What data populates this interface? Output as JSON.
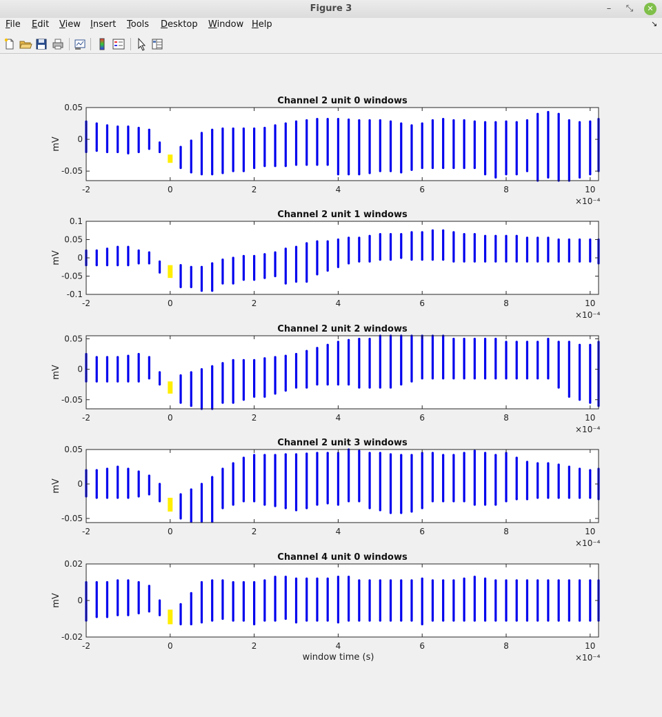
{
  "window": {
    "title": "Figure 3"
  },
  "menu": [
    "File",
    "Edit",
    "View",
    "Insert",
    "Tools",
    "Desktop",
    "Window",
    "Help"
  ],
  "menu_mnemonics": [
    "F",
    "E",
    "V",
    "I",
    "T",
    "D",
    "W",
    "H"
  ],
  "toolbar_icons": [
    "new-figure-icon",
    "open-file-icon",
    "save-icon",
    "print-icon",
    "link-plot-icon",
    "colorbar-icon",
    "legend-icon",
    "pointer-icon",
    "property-editor-icon"
  ],
  "colors": {
    "data": "#0000ee",
    "highlight": "#ffee00"
  },
  "chart_data": [
    {
      "type": "scatter",
      "title": "Channel 2 unit 0 windows",
      "xlabel": "",
      "ylabel": "mV",
      "xlim": [
        -2,
        10.2
      ],
      "ylim": [
        -0.065,
        0.05
      ],
      "xticks": [
        -2,
        0,
        2,
        4,
        6,
        8,
        10
      ],
      "yticks": [
        0.05,
        0,
        -0.05
      ],
      "ytick_labels": [
        "0.05",
        "0",
        "-0.05"
      ],
      "x_exponent_label": "×10⁻⁴",
      "highlight_x": 0,
      "highlight_range": [
        -0.037,
        -0.024
      ],
      "x": [
        -2,
        -1.75,
        -1.5,
        -1.25,
        -1,
        -0.75,
        -0.5,
        -0.25,
        0.25,
        0.5,
        0.75,
        1,
        1.25,
        1.5,
        1.75,
        2,
        2.25,
        2.5,
        2.75,
        3,
        3.25,
        3.5,
        3.75,
        4,
        4.25,
        4.5,
        4.75,
        5,
        5.25,
        5.5,
        5.75,
        6,
        6.25,
        6.5,
        6.75,
        7,
        7.25,
        7.5,
        7.75,
        8,
        8.25,
        8.5,
        8.75,
        9,
        9.25,
        9.5,
        9.75,
        10,
        10.2
      ],
      "y_top": [
        0.028,
        0.025,
        0.022,
        0.02,
        0.02,
        0.018,
        0.015,
        -0.005,
        -0.012,
        -0.002,
        0.01,
        0.015,
        0.017,
        0.017,
        0.017,
        0.017,
        0.018,
        0.022,
        0.025,
        0.028,
        0.03,
        0.032,
        0.032,
        0.032,
        0.031,
        0.03,
        0.03,
        0.03,
        0.028,
        0.025,
        0.022,
        0.025,
        0.03,
        0.032,
        0.03,
        0.03,
        0.028,
        0.027,
        0.027,
        0.028,
        0.027,
        0.03,
        0.04,
        0.043,
        0.04,
        0.03,
        0.027,
        0.028,
        0.032
      ],
      "y_bottom": [
        -0.02,
        -0.018,
        -0.02,
        -0.02,
        -0.022,
        -0.02,
        -0.015,
        -0.02,
        -0.045,
        -0.052,
        -0.055,
        -0.055,
        -0.053,
        -0.05,
        -0.05,
        -0.045,
        -0.042,
        -0.042,
        -0.042,
        -0.04,
        -0.04,
        -0.04,
        -0.04,
        -0.055,
        -0.055,
        -0.055,
        -0.053,
        -0.05,
        -0.05,
        -0.052,
        -0.048,
        -0.045,
        -0.045,
        -0.045,
        -0.045,
        -0.045,
        -0.045,
        -0.055,
        -0.06,
        -0.055,
        -0.055,
        -0.05,
        -0.065,
        -0.06,
        -0.065,
        -0.065,
        -0.06,
        -0.055,
        -0.05
      ]
    },
    {
      "type": "scatter",
      "title": "Channel 2 unit 1 windows",
      "xlabel": "",
      "ylabel": "mV",
      "xlim": [
        -2,
        10.2
      ],
      "ylim": [
        -0.1,
        0.1
      ],
      "xticks": [
        -2,
        0,
        2,
        4,
        6,
        8,
        10
      ],
      "yticks": [
        0.1,
        0.05,
        0,
        -0.05,
        -0.1
      ],
      "ytick_labels": [
        "0.1",
        "0.05",
        "0",
        "-0.05",
        "-0.1"
      ],
      "x_exponent_label": "×10⁻⁴",
      "highlight_x": 0,
      "highlight_range": [
        -0.055,
        -0.02
      ],
      "x": [
        -2,
        -1.75,
        -1.5,
        -1.25,
        -1,
        -0.75,
        -0.5,
        -0.25,
        0.25,
        0.5,
        0.75,
        1,
        1.25,
        1.5,
        1.75,
        2,
        2.25,
        2.5,
        2.75,
        3,
        3.25,
        3.5,
        3.75,
        4,
        4.25,
        4.5,
        4.75,
        5,
        5.25,
        5.5,
        5.75,
        6,
        6.25,
        6.5,
        6.75,
        7,
        7.25,
        7.5,
        7.75,
        8,
        8.25,
        8.5,
        8.75,
        9,
        9.25,
        9.5,
        9.75,
        10,
        10.2
      ],
      "y_top": [
        0.02,
        0.02,
        0.025,
        0.03,
        0.03,
        0.02,
        0.015,
        -0.01,
        -0.02,
        -0.025,
        -0.025,
        -0.015,
        -0.005,
        0.0,
        0.005,
        0.005,
        0.01,
        0.015,
        0.025,
        0.03,
        0.04,
        0.045,
        0.045,
        0.05,
        0.055,
        0.055,
        0.06,
        0.065,
        0.065,
        0.065,
        0.07,
        0.07,
        0.075,
        0.075,
        0.07,
        0.065,
        0.065,
        0.06,
        0.06,
        0.06,
        0.06,
        0.055,
        0.055,
        0.055,
        0.05,
        0.05,
        0.05,
        0.05,
        0.05
      ],
      "y_bottom": [
        -0.02,
        -0.02,
        -0.02,
        -0.02,
        -0.02,
        -0.015,
        -0.015,
        -0.04,
        -0.08,
        -0.08,
        -0.09,
        -0.09,
        -0.07,
        -0.07,
        -0.06,
        -0.06,
        -0.055,
        -0.05,
        -0.07,
        -0.065,
        -0.065,
        -0.045,
        -0.035,
        -0.025,
        -0.015,
        -0.01,
        -0.01,
        -0.005,
        -0.005,
        0.0,
        -0.005,
        -0.005,
        -0.005,
        -0.005,
        -0.01,
        -0.01,
        -0.01,
        -0.01,
        -0.01,
        -0.01,
        -0.01,
        -0.01,
        -0.01,
        -0.01,
        -0.01,
        -0.01,
        -0.01,
        -0.01,
        -0.015
      ]
    },
    {
      "type": "scatter",
      "title": "Channel 2 unit 2 windows",
      "xlabel": "",
      "ylabel": "mV",
      "xlim": [
        -2,
        10.2
      ],
      "ylim": [
        -0.065,
        0.055
      ],
      "xticks": [
        -2,
        0,
        2,
        4,
        6,
        8,
        10
      ],
      "yticks": [
        0.05,
        0,
        -0.05
      ],
      "ytick_labels": [
        "0.05",
        "0",
        "-0.05"
      ],
      "x_exponent_label": "×10⁻⁴",
      "highlight_x": 0,
      "highlight_range": [
        -0.04,
        -0.02
      ],
      "x": [
        -2,
        -1.75,
        -1.5,
        -1.25,
        -1,
        -0.75,
        -0.5,
        -0.25,
        0.25,
        0.5,
        0.75,
        1,
        1.25,
        1.5,
        1.75,
        2,
        2.25,
        2.5,
        2.75,
        3,
        3.25,
        3.5,
        3.75,
        4,
        4.25,
        4.5,
        4.75,
        5,
        5.25,
        5.5,
        5.75,
        6,
        6.25,
        6.5,
        6.75,
        7,
        7.25,
        7.5,
        7.75,
        8,
        8.25,
        8.5,
        8.75,
        9,
        9.25,
        9.5,
        9.75,
        10,
        10.2
      ],
      "y_top": [
        0.025,
        0.02,
        0.02,
        0.02,
        0.022,
        0.025,
        0.02,
        -0.005,
        -0.01,
        -0.005,
        0.0,
        0.005,
        0.01,
        0.015,
        0.015,
        0.015,
        0.018,
        0.02,
        0.022,
        0.025,
        0.03,
        0.035,
        0.04,
        0.045,
        0.048,
        0.05,
        0.05,
        0.055,
        0.055,
        0.055,
        0.055,
        0.055,
        0.055,
        0.055,
        0.05,
        0.05,
        0.05,
        0.05,
        0.05,
        0.045,
        0.045,
        0.045,
        0.045,
        0.05,
        0.045,
        0.045,
        0.04,
        0.04,
        0.045
      ],
      "y_bottom": [
        -0.02,
        -0.02,
        -0.02,
        -0.02,
        -0.02,
        -0.02,
        -0.015,
        -0.025,
        -0.055,
        -0.06,
        -0.065,
        -0.065,
        -0.055,
        -0.055,
        -0.05,
        -0.045,
        -0.045,
        -0.04,
        -0.035,
        -0.03,
        -0.03,
        -0.025,
        -0.025,
        -0.025,
        -0.025,
        -0.03,
        -0.03,
        -0.03,
        -0.03,
        -0.025,
        -0.02,
        -0.015,
        -0.015,
        -0.015,
        -0.015,
        -0.015,
        -0.015,
        -0.015,
        -0.015,
        -0.015,
        -0.015,
        -0.015,
        -0.015,
        -0.015,
        -0.03,
        -0.045,
        -0.05,
        -0.055,
        -0.06
      ]
    },
    {
      "type": "scatter",
      "title": "Channel 2 unit 3 windows",
      "xlabel": "",
      "ylabel": "mV",
      "xlim": [
        -2,
        10.2
      ],
      "ylim": [
        -0.056,
        0.05
      ],
      "xticks": [
        -2,
        0,
        2,
        4,
        6,
        8,
        10
      ],
      "yticks": [
        0.05,
        0,
        -0.05
      ],
      "ytick_labels": [
        "0.05",
        "0",
        "-0.05"
      ],
      "x_exponent_label": "×10⁻⁴",
      "highlight_x": 0,
      "highlight_range": [
        -0.04,
        -0.02
      ],
      "x": [
        -2,
        -1.75,
        -1.5,
        -1.25,
        -1,
        -0.75,
        -0.5,
        -0.25,
        0.25,
        0.5,
        0.75,
        1,
        1.25,
        1.5,
        1.75,
        2,
        2.25,
        2.5,
        2.75,
        3,
        3.25,
        3.5,
        3.75,
        4,
        4.25,
        4.5,
        4.75,
        5,
        5.25,
        5.5,
        5.75,
        6,
        6.25,
        6.5,
        6.75,
        7,
        7.25,
        7.5,
        7.75,
        8,
        8.25,
        8.5,
        8.75,
        9,
        9.25,
        9.5,
        9.75,
        10,
        10.2
      ],
      "y_top": [
        0.02,
        0.02,
        0.022,
        0.025,
        0.022,
        0.018,
        0.012,
        0.0,
        -0.015,
        -0.008,
        0.0,
        0.01,
        0.022,
        0.03,
        0.038,
        0.042,
        0.042,
        0.042,
        0.043,
        0.043,
        0.044,
        0.045,
        0.045,
        0.045,
        0.05,
        0.048,
        0.045,
        0.045,
        0.043,
        0.042,
        0.042,
        0.045,
        0.045,
        0.042,
        0.042,
        0.045,
        0.048,
        0.045,
        0.042,
        0.045,
        0.038,
        0.032,
        0.03,
        0.03,
        0.028,
        0.025,
        0.022,
        0.02,
        0.022
      ],
      "y_bottom": [
        -0.018,
        -0.02,
        -0.02,
        -0.02,
        -0.02,
        -0.018,
        -0.015,
        -0.025,
        -0.05,
        -0.055,
        -0.055,
        -0.055,
        -0.035,
        -0.03,
        -0.025,
        -0.025,
        -0.03,
        -0.032,
        -0.035,
        -0.038,
        -0.035,
        -0.03,
        -0.028,
        -0.03,
        -0.025,
        -0.025,
        -0.035,
        -0.038,
        -0.042,
        -0.042,
        -0.04,
        -0.035,
        -0.025,
        -0.025,
        -0.025,
        -0.025,
        -0.03,
        -0.03,
        -0.03,
        -0.025,
        -0.022,
        -0.022,
        -0.02,
        -0.02,
        -0.02,
        -0.02,
        -0.02,
        -0.02,
        -0.022
      ]
    },
    {
      "type": "scatter",
      "title": "Channel 4 unit 0 windows",
      "xlabel": "window time (s)",
      "ylabel": "mV",
      "xlim": [
        -2,
        10.2
      ],
      "ylim": [
        -0.02,
        0.02
      ],
      "xticks": [
        -2,
        0,
        2,
        4,
        6,
        8,
        10
      ],
      "yticks": [
        0.02,
        0,
        -0.02
      ],
      "ytick_labels": [
        "0.02",
        "0",
        "-0.02"
      ],
      "x_exponent_label": "×10⁻⁴",
      "highlight_x": 0,
      "highlight_range": [
        -0.013,
        -0.005
      ],
      "x": [
        -2,
        -1.75,
        -1.5,
        -1.25,
        -1,
        -0.75,
        -0.5,
        -0.25,
        0.25,
        0.5,
        0.75,
        1,
        1.25,
        1.5,
        1.75,
        2,
        2.25,
        2.5,
        2.75,
        3,
        3.25,
        3.5,
        3.75,
        4,
        4.25,
        4.5,
        4.75,
        5,
        5.25,
        5.5,
        5.75,
        6,
        6.25,
        6.5,
        6.75,
        7,
        7.25,
        7.5,
        7.75,
        8,
        8.25,
        8.5,
        8.75,
        9,
        9.25,
        9.5,
        9.75,
        10,
        10.2
      ],
      "y_top": [
        0.01,
        0.01,
        0.01,
        0.011,
        0.011,
        0.01,
        0.008,
        0.0,
        -0.002,
        0.004,
        0.01,
        0.011,
        0.011,
        0.01,
        0.01,
        0.01,
        0.011,
        0.013,
        0.013,
        0.012,
        0.012,
        0.012,
        0.012,
        0.013,
        0.013,
        0.011,
        0.011,
        0.011,
        0.011,
        0.011,
        0.011,
        0.012,
        0.011,
        0.011,
        0.011,
        0.012,
        0.013,
        0.012,
        0.011,
        0.011,
        0.011,
        0.011,
        0.011,
        0.011,
        0.011,
        0.011,
        0.011,
        0.011,
        0.011
      ],
      "y_bottom": [
        -0.011,
        -0.009,
        -0.009,
        -0.008,
        -0.008,
        -0.007,
        -0.006,
        -0.008,
        -0.013,
        -0.013,
        -0.012,
        -0.011,
        -0.01,
        -0.011,
        -0.011,
        -0.013,
        -0.011,
        -0.011,
        -0.01,
        -0.012,
        -0.011,
        -0.011,
        -0.011,
        -0.012,
        -0.011,
        -0.011,
        -0.011,
        -0.011,
        -0.011,
        -0.011,
        -0.011,
        -0.013,
        -0.011,
        -0.011,
        -0.011,
        -0.011,
        -0.011,
        -0.011,
        -0.011,
        -0.011,
        -0.011,
        -0.011,
        -0.011,
        -0.011,
        -0.011,
        -0.011,
        -0.011,
        -0.011,
        -0.011
      ]
    }
  ]
}
